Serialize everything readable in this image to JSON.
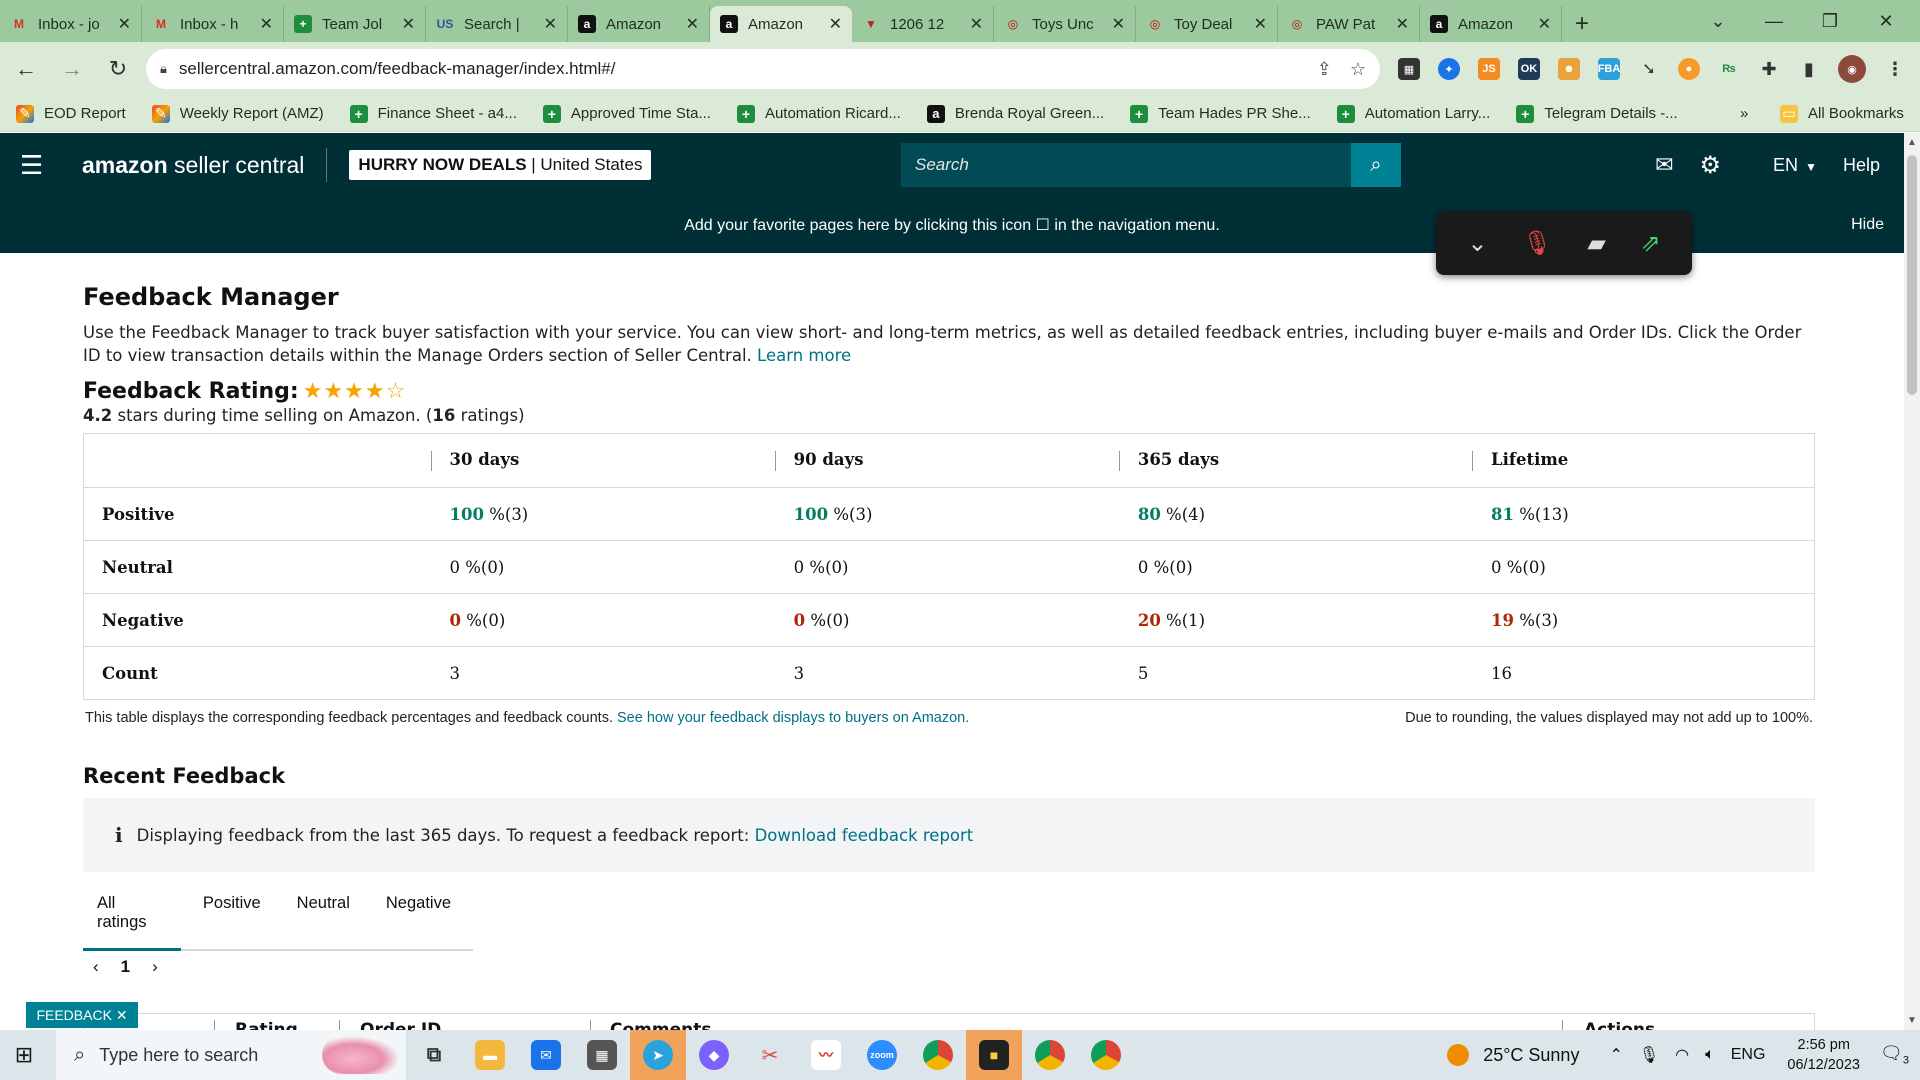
{
  "browser": {
    "tabs": [
      {
        "label": "Inbox - jo",
        "icon": "gmail-icon",
        "color": "#d93025"
      },
      {
        "label": "Inbox - h",
        "icon": "gmail-icon",
        "color": "#d93025"
      },
      {
        "label": "Team Jol",
        "icon": "sheets-plus-icon",
        "color": "#1e8e3e"
      },
      {
        "label": "Search |",
        "icon": "us-flag-icon",
        "color": "#2b5797"
      },
      {
        "label": "Amazon",
        "icon": "amazon-icon",
        "color": "#111111"
      },
      {
        "label": "Amazon",
        "icon": "amazon-icon",
        "color": "#111111",
        "active": true
      },
      {
        "label": "1206 12",
        "icon": "red-v-icon",
        "color": "#c5221f"
      },
      {
        "label": "Toys Unc",
        "icon": "target-icon",
        "color": "#cc0000"
      },
      {
        "label": "Toy Deal",
        "icon": "target-icon",
        "color": "#cc0000"
      },
      {
        "label": "PAW Pat",
        "icon": "target-icon",
        "color": "#cc0000"
      },
      {
        "label": "Amazon",
        "icon": "amazon-icon",
        "color": "#111111"
      }
    ],
    "url": "sellercentral.amazon.com/feedback-manager/index.html#/",
    "bookmarks": [
      {
        "label": "EOD Report",
        "type": "eod"
      },
      {
        "label": "Weekly Report (AMZ)",
        "type": "eod"
      },
      {
        "label": "Finance Sheet - a4...",
        "type": "plus"
      },
      {
        "label": "Approved Time Sta...",
        "type": "plus"
      },
      {
        "label": "Automation Ricard...",
        "type": "plus"
      },
      {
        "label": "Brenda Royal Green...",
        "type": "amz"
      },
      {
        "label": "Team Hades PR She...",
        "type": "plus"
      },
      {
        "label": "Automation Larry...",
        "type": "plus"
      },
      {
        "label": "Telegram Details -...",
        "type": "plus"
      }
    ],
    "bookmarks_overflow": "»",
    "all_bookmarks": "All Bookmarks"
  },
  "header": {
    "logo_strong": "amazon",
    "logo_rest": " seller central",
    "store_name": "HURRY NOW DEALS",
    "store_region": " | United States",
    "search_placeholder": "Search",
    "language": "EN",
    "help": "Help"
  },
  "favorites_bar": {
    "message": "Add your favorite pages here by clicking this icon ☐ in the navigation menu.",
    "hide": "Hide"
  },
  "page": {
    "title": "Feedback Manager",
    "description": "Use the Feedback Manager to track buyer satisfaction with your service. You can view short- and long-term metrics, as well as detailed feedback entries, including buyer e-mails and Order IDs. Click the Order ID to view transaction details within the Manage Orders section of Seller Central.",
    "learn_more": "Learn more",
    "rating_label": "Feedback Rating:",
    "rating_value": "4.2",
    "rating_text_mid": " stars during time selling on Amazon. (",
    "rating_count": "16",
    "rating_text_end": " ratings)"
  },
  "feedback_table": {
    "columns": [
      "30 days",
      "90 days",
      "365 days",
      "Lifetime"
    ],
    "rows": [
      {
        "label": "Positive",
        "cells": [
          {
            "pct": "100",
            "rest": " %(3)"
          },
          {
            "pct": "100",
            "rest": " %(3)"
          },
          {
            "pct": "80",
            "rest": " %(4)"
          },
          {
            "pct": "81",
            "rest": " %(13)"
          }
        ]
      },
      {
        "label": "Neutral",
        "cells": [
          {
            "pct": "0",
            "rest": " %(0)"
          },
          {
            "pct": "0",
            "rest": " %(0)"
          },
          {
            "pct": "0",
            "rest": " %(0)"
          },
          {
            "pct": "0",
            "rest": " %(0)"
          }
        ]
      },
      {
        "label": "Negative",
        "cells": [
          {
            "pct": "0",
            "rest": " %(0)"
          },
          {
            "pct": "0",
            "rest": " %(0)"
          },
          {
            "pct": "20",
            "rest": " %(1)"
          },
          {
            "pct": "19",
            "rest": " %(3)"
          }
        ]
      },
      {
        "label": "Count",
        "cells": [
          {
            "pct": "3",
            "rest": ""
          },
          {
            "pct": "3",
            "rest": ""
          },
          {
            "pct": "5",
            "rest": ""
          },
          {
            "pct": "16",
            "rest": ""
          }
        ]
      }
    ],
    "note": "This table displays the corresponding feedback percentages and feedback counts.",
    "note_link": "See how your feedback displays to buyers on Amazon.",
    "rounding_note": "Due to rounding, the values displayed may not add up to 100%."
  },
  "recent": {
    "title": "Recent Feedback",
    "info_text": "Displaying feedback from the last 365 days. To request a feedback report:",
    "info_link": "Download feedback report",
    "tabs": [
      "All ratings",
      "Positive",
      "Neutral",
      "Negative"
    ],
    "page": "1",
    "columns": [
      "Rating",
      "Order ID",
      "Comments",
      "Actions"
    ]
  },
  "feedback_button": "FEEDBACK",
  "taskbar": {
    "search_placeholder": "Type here to search",
    "weather": "25°C  Sunny",
    "lang": "ENG",
    "time": "2:56 pm",
    "date": "06/12/2023",
    "notif_count": "3"
  },
  "colors": {
    "header_bg": "#002f36",
    "link": "#007185",
    "positive": "#067d62",
    "negative": "#b12704",
    "star": "#f7a300"
  }
}
